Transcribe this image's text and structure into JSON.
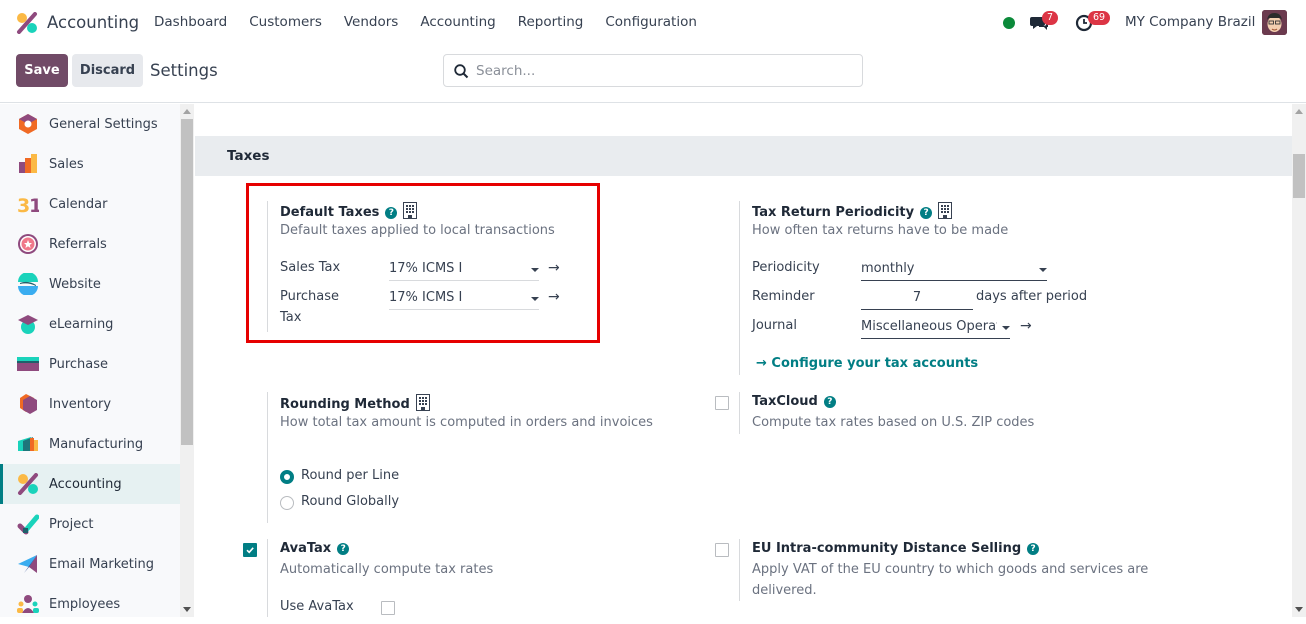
{
  "app": {
    "name": "Accounting"
  },
  "menu": [
    "Dashboard",
    "Customers",
    "Vendors",
    "Accounting",
    "Reporting",
    "Configuration"
  ],
  "systray": {
    "messages_count": "7",
    "activities_count": "69",
    "company": "MY Company Brazil",
    "status_color": "#0b8a3a"
  },
  "controlbar": {
    "save_label": "Save",
    "discard_label": "Discard",
    "title": "Settings",
    "search_placeholder": "Search...",
    "search_value": ""
  },
  "sidebar": {
    "items": [
      {
        "label": "General Settings",
        "icon": "general-settings-icon"
      },
      {
        "label": "Sales",
        "icon": "sales-icon"
      },
      {
        "label": "Calendar",
        "icon": "calendar-icon"
      },
      {
        "label": "Referrals",
        "icon": "referrals-icon"
      },
      {
        "label": "Website",
        "icon": "website-icon"
      },
      {
        "label": "eLearning",
        "icon": "elearning-icon"
      },
      {
        "label": "Purchase",
        "icon": "purchase-icon"
      },
      {
        "label": "Inventory",
        "icon": "inventory-icon"
      },
      {
        "label": "Manufacturing",
        "icon": "manufacturing-icon"
      },
      {
        "label": "Accounting",
        "icon": "accounting-icon",
        "active": true
      },
      {
        "label": "Project",
        "icon": "project-icon"
      },
      {
        "label": "Email Marketing",
        "icon": "email-marketing-icon"
      },
      {
        "label": "Employees",
        "icon": "employees-icon"
      }
    ]
  },
  "section": {
    "title": "Taxes"
  },
  "default_taxes": {
    "title": "Default Taxes",
    "description": "Default taxes applied to local transactions",
    "sales_tax_label": "Sales Tax",
    "sales_tax_value": "17% ICMS I",
    "purchase_tax_label_1": "Purchase",
    "purchase_tax_label_2": "Tax",
    "purchase_tax_value": "17% ICMS I"
  },
  "tax_return": {
    "title": "Tax Return Periodicity",
    "description": "How often tax returns have to be made",
    "periodicity_label": "Periodicity",
    "periodicity_value": "monthly",
    "reminder_label": "Reminder",
    "reminder_value": "7",
    "reminder_suffix": "days after period",
    "journal_label": "Journal",
    "journal_value": "Miscellaneous Operat",
    "configure_link": "Configure your tax accounts"
  },
  "rounding": {
    "title": "Rounding Method",
    "description": "How total tax amount is computed in orders and invoices",
    "options": [
      {
        "label": "Round per Line",
        "selected": true
      },
      {
        "label": "Round Globally",
        "selected": false
      }
    ]
  },
  "taxcloud": {
    "title": "TaxCloud",
    "description": "Compute tax rates based on U.S. ZIP codes",
    "checked": false
  },
  "avatax": {
    "title": "AvaTax",
    "description": "Automatically compute tax rates",
    "checked": true,
    "use_label": "Use AvaTax",
    "use_checked": false
  },
  "eu_distance": {
    "title": "EU Intra-community Distance Selling",
    "description_1": "Apply VAT of the EU country to which goods and services are",
    "description_2": "delivered.",
    "checked": false
  },
  "colors": {
    "brand": "#714b67",
    "accent": "#017e84",
    "highlight_box": "#e60000",
    "badge": "#dc3545"
  }
}
